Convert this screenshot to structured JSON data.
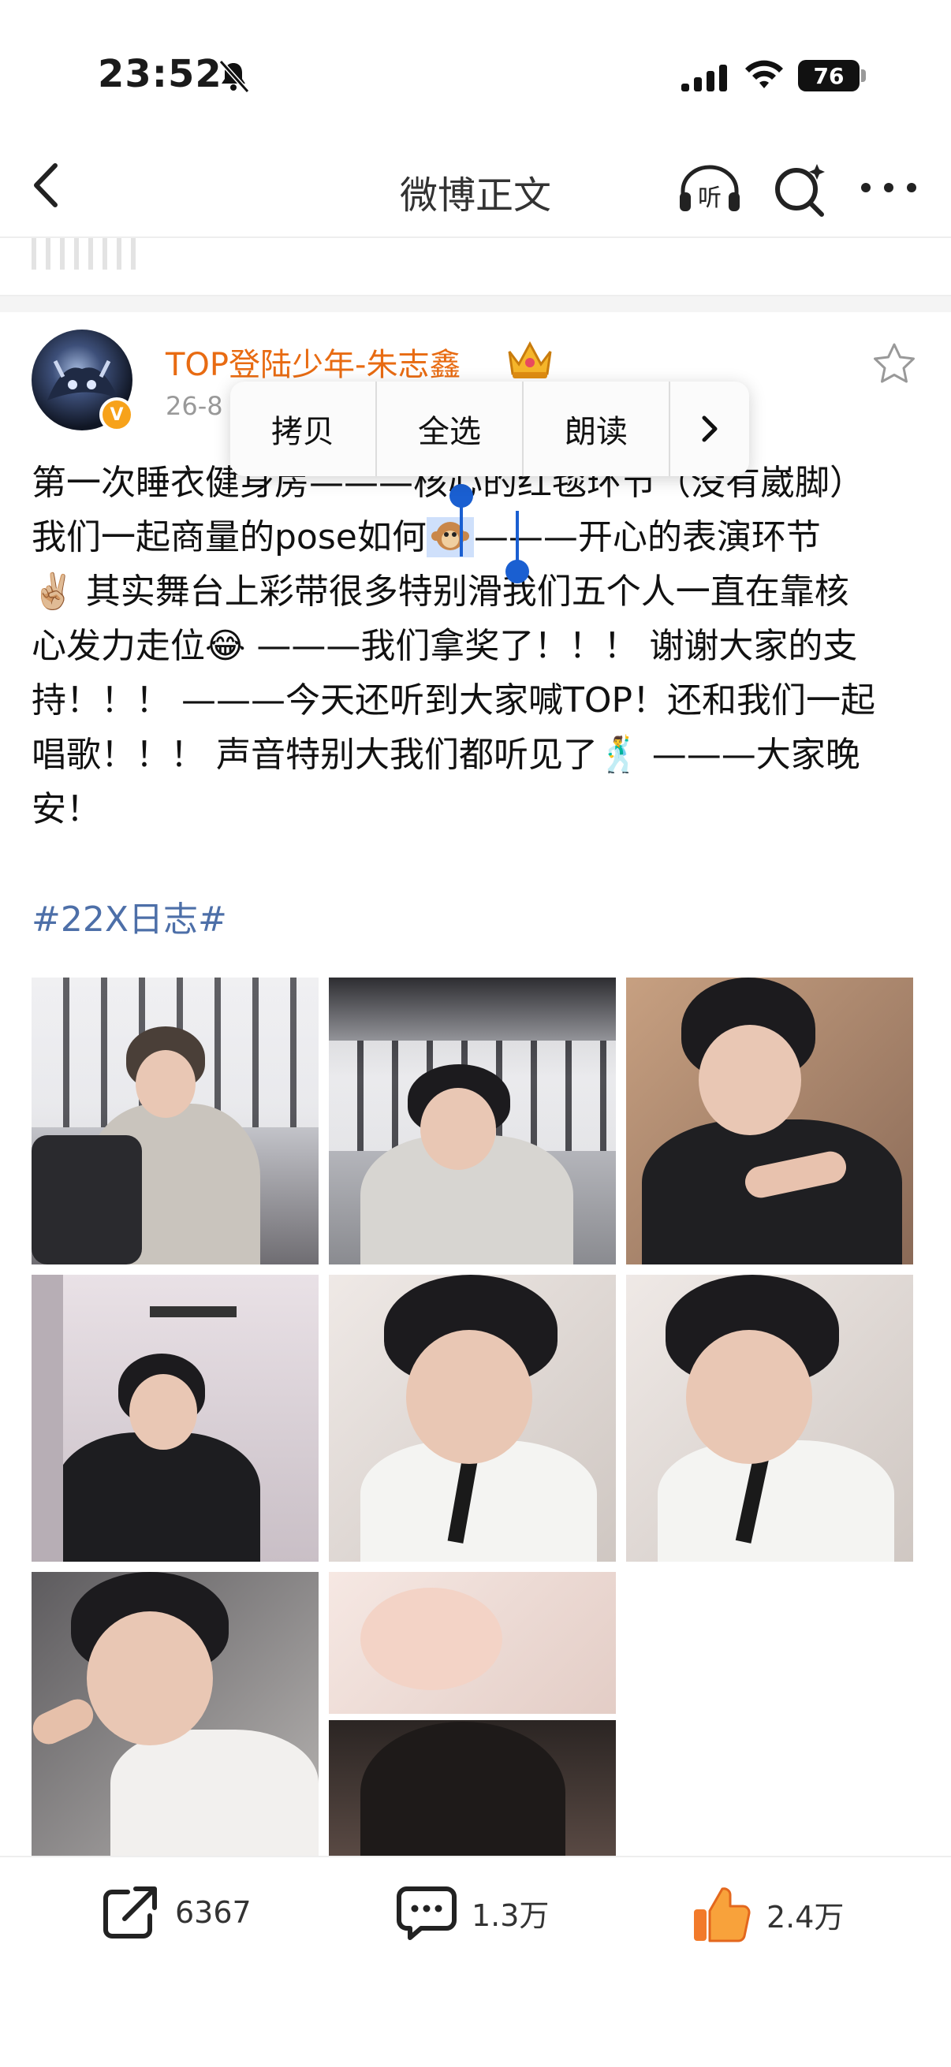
{
  "status": {
    "time": "23:52",
    "battery": "76"
  },
  "nav": {
    "title": "微博正文",
    "listen_label": "听"
  },
  "post": {
    "author": "TOP登陆少年-朱志鑫",
    "date": "26-8",
    "text_line1_a": "第一次睡衣健身房",
    "text_line1_b": "———",
    "text_line1_c": "核心的红毯环节（没有崴脚）",
    "text_line2_a": "我们一起商量的pose如何",
    "text_line2_b": "———开心的表演环节",
    "text_line3": "✌🏼 其实舞台上彩带很多特别滑我们五个人一直在靠核",
    "text_line4": "心发力走位😂 ———我们拿奖了！！！ 谢谢大家的支",
    "text_line5": "持！！！ ———今天还听到大家喊TOP！还和我们一起",
    "text_line6": "唱歌！！！ 声音特别大我们都听见了🕺 ———大家晚",
    "text_line7": "安！",
    "hashtag": "#22X日志#"
  },
  "context_menu": {
    "items": [
      "拷贝",
      "全选",
      "朗读"
    ]
  },
  "actions": {
    "repost_count": "6367",
    "comment_count": "1.3万",
    "like_count": "2.4万"
  },
  "colors": {
    "author": "#e86b12",
    "hashtag": "#4d6fa8",
    "selection": "#1a5fd1",
    "like": "#f27a2a"
  }
}
